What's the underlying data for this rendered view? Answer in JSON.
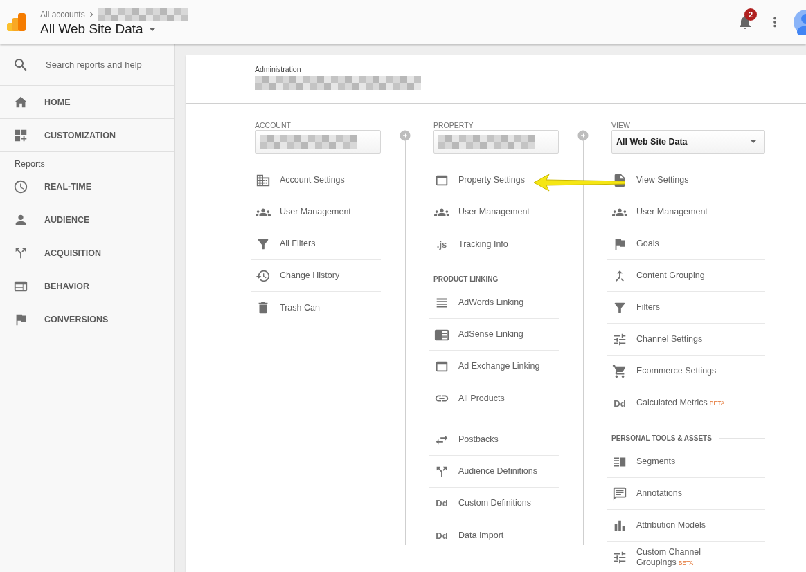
{
  "header": {
    "breadcrumb": "All accounts",
    "title": "All Web Site Data",
    "notification_count": "2"
  },
  "sidebar": {
    "search_placeholder": "Search reports and help",
    "top_items": [
      {
        "label": "HOME",
        "kind": "home"
      },
      {
        "label": "CUSTOMIZATION",
        "kind": "customize"
      }
    ],
    "section_label": "Reports",
    "report_items": [
      {
        "label": "REAL-TIME",
        "kind": "clock"
      },
      {
        "label": "AUDIENCE",
        "kind": "person"
      },
      {
        "label": "ACQUISITION",
        "kind": "split"
      },
      {
        "label": "BEHAVIOR",
        "kind": "web"
      },
      {
        "label": "CONVERSIONS",
        "kind": "flag"
      }
    ]
  },
  "admin": {
    "title": "Administration",
    "columns": [
      {
        "heading": "ACCOUNT",
        "selector": {
          "kind": "redacted"
        },
        "sections": [
          {
            "items": [
              {
                "label": "Account Settings",
                "kind": "building"
              },
              {
                "label": "User Management",
                "kind": "people"
              },
              {
                "label": "All Filters",
                "kind": "funnel"
              },
              {
                "label": "Change History",
                "kind": "history"
              },
              {
                "label": "Trash Can",
                "kind": "trash"
              }
            ]
          }
        ]
      },
      {
        "heading": "PROPERTY",
        "selector": {
          "kind": "redacted"
        },
        "sections": [
          {
            "items": [
              {
                "label": "Property Settings",
                "kind": "panel"
              },
              {
                "label": "User Management",
                "kind": "people"
              },
              {
                "label": "Tracking Info",
                "kind": "glyph",
                "glyph": ".js"
              }
            ]
          },
          {
            "heading": "PRODUCT LINKING",
            "items": [
              {
                "label": "AdWords Linking",
                "kind": "lines"
              },
              {
                "label": "AdSense Linking",
                "kind": "reader"
              },
              {
                "label": "Ad Exchange Linking",
                "kind": "panel"
              },
              {
                "label": "All Products",
                "kind": "link"
              }
            ]
          },
          {
            "items": [
              {
                "label": "Postbacks",
                "kind": "swap"
              },
              {
                "label": "Audience Definitions",
                "kind": "fork"
              },
              {
                "label": "Custom Definitions",
                "kind": "glyph",
                "glyph": "Dd"
              },
              {
                "label": "Data Import",
                "kind": "glyph",
                "glyph": "Dd"
              }
            ]
          }
        ]
      },
      {
        "heading": "VIEW",
        "selector": {
          "kind": "select",
          "value": "All Web Site Data"
        },
        "sections": [
          {
            "items": [
              {
                "label": "View Settings",
                "kind": "doc"
              },
              {
                "label": "User Management",
                "kind": "people"
              },
              {
                "label": "Goals",
                "kind": "flag"
              },
              {
                "label": "Content Grouping",
                "kind": "merge"
              },
              {
                "label": "Filters",
                "kind": "funnel"
              },
              {
                "label": "Channel Settings",
                "kind": "tune"
              },
              {
                "label": "Ecommerce Settings",
                "kind": "cart"
              },
              {
                "label": "Calculated Metrics",
                "kind": "glyph",
                "glyph": "Dd",
                "badge": "BETA"
              }
            ]
          },
          {
            "heading": "PERSONAL TOOLS & ASSETS",
            "items": [
              {
                "label": "Segments",
                "kind": "segments"
              },
              {
                "label": "Annotations",
                "kind": "chat"
              },
              {
                "label": "Attribution Models",
                "kind": "bars"
              },
              {
                "label": "Custom Channel Groupings",
                "kind": "tunebox",
                "badge": "BETA"
              }
            ]
          }
        ]
      }
    ]
  }
}
